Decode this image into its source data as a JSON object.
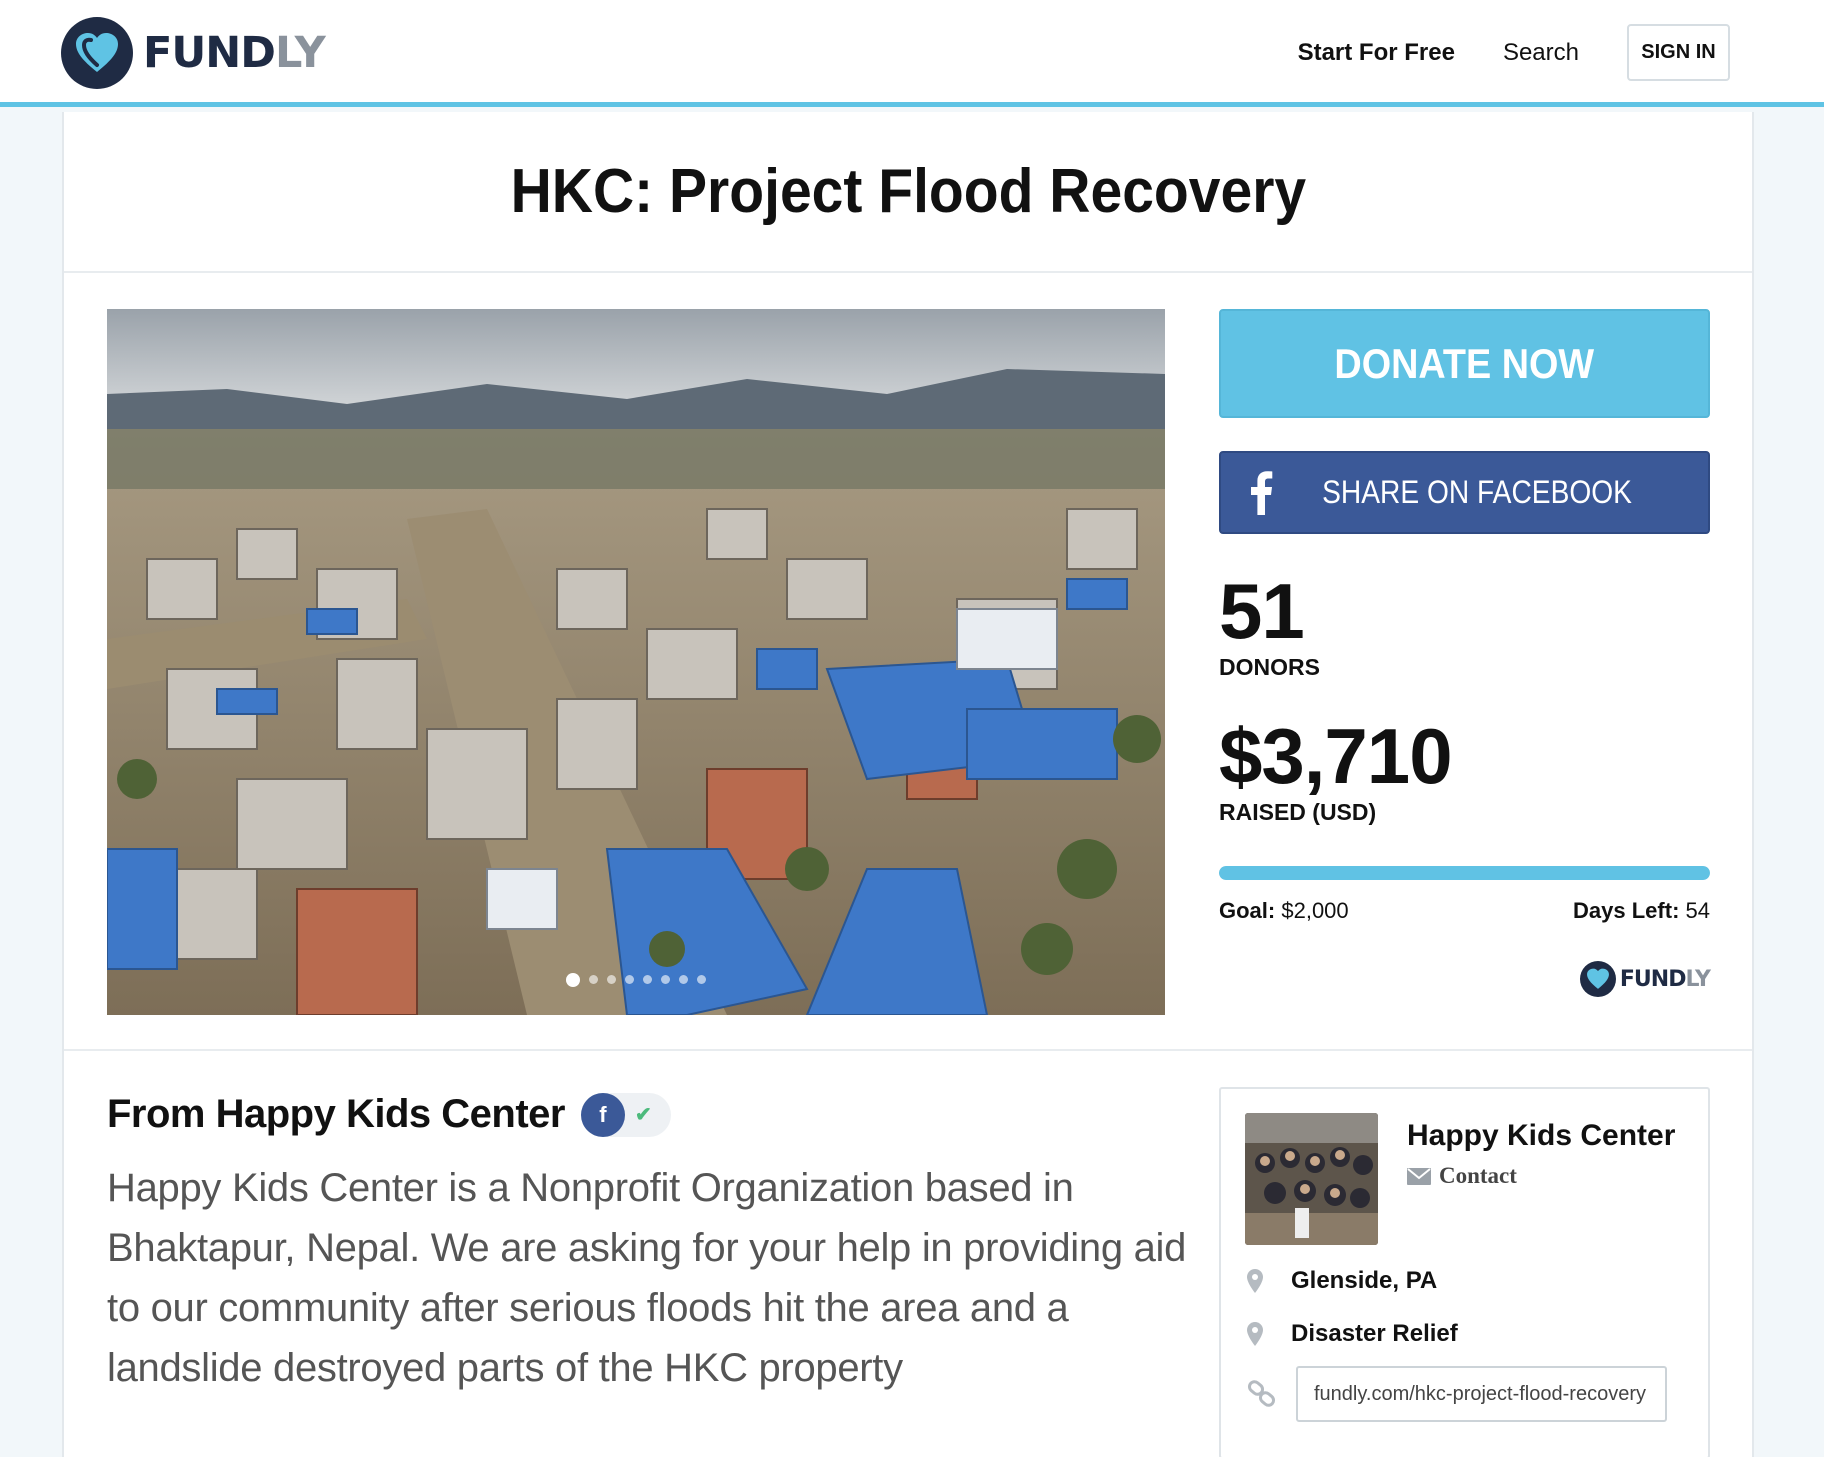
{
  "header": {
    "logo_text_main": "FUND",
    "logo_text_tail": "LY",
    "nav": {
      "start_label": "Start For Free",
      "search_label": "Search",
      "sign_in_label": "SIGN IN"
    }
  },
  "campaign": {
    "title": "HKC: Project Flood Recovery",
    "donate_label": "DONATE NOW",
    "facebook_label": "SHARE ON FACEBOOK",
    "donors_count": "51",
    "donors_label": "DONORS",
    "raised_amount": "$3,710",
    "raised_label": "RAISED (USD)",
    "progress_fraction": 1.0,
    "goal_label": "Goal:",
    "goal_value": "$2,000",
    "days_left_label": "Days Left:",
    "days_left_value": "54",
    "slideshow": {
      "count": 8,
      "active": 0
    }
  },
  "organizer": {
    "heading": "From Happy Kids Center",
    "verify_fb": "f",
    "verify_check": "✔",
    "description": "Happy Kids Center is a Nonprofit Organization based in Bhaktapur, Nepal. We are asking for your help in providing aid to our community after serious floods hit the area and a landslide destroyed parts of the HKC property",
    "card": {
      "name": "Happy Kids Center",
      "contact_label": "Contact",
      "location": "Glenside, PA",
      "category": "Disaster Relief",
      "url": "fundly.com/hkc-project-flood-recovery"
    }
  },
  "colors": {
    "accent": "#60c2e4",
    "facebook": "#3b5998",
    "logo_dark": "#1f2b44"
  },
  "icons": [
    "heart-logo-icon",
    "facebook-icon",
    "check-icon",
    "mail-icon",
    "location-pin-icon",
    "link-icon"
  ]
}
